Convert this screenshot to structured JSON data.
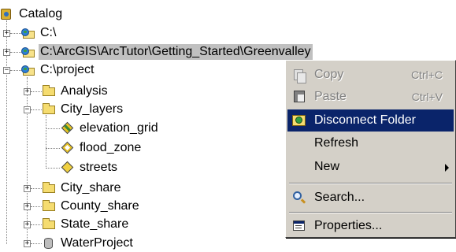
{
  "tree": {
    "root": {
      "label": "Catalog",
      "icon": "catalog-icon"
    },
    "items": [
      {
        "label": "C:\\",
        "icon": "drive-globe-icon",
        "expander": "+"
      },
      {
        "label": "C:\\ArcGIS\\ArcTutor\\Getting_Started\\Greenvalley",
        "icon": "drive-globe-icon",
        "expander": "+",
        "selected": true
      },
      {
        "label": "C:\\project",
        "icon": "drive-globe-icon",
        "expander": "−"
      },
      {
        "label": "Analysis",
        "icon": "folder-icon",
        "expander": "+"
      },
      {
        "label": "City_layers",
        "icon": "folder-icon",
        "expander": "−"
      },
      {
        "label": "elevation_grid",
        "icon": "raster-icon"
      },
      {
        "label": "flood_zone",
        "icon": "polygon-layer-icon"
      },
      {
        "label": "streets",
        "icon": "line-layer-icon"
      },
      {
        "label": "City_share",
        "icon": "folder-icon",
        "expander": "+"
      },
      {
        "label": "County_share",
        "icon": "folder-icon",
        "expander": "+"
      },
      {
        "label": "State_share",
        "icon": "folder-icon",
        "expander": "+"
      },
      {
        "label": "WaterProject",
        "icon": "database-icon",
        "expander": "+"
      }
    ]
  },
  "context_menu": {
    "items": [
      {
        "label": "Copy",
        "shortcut": "Ctrl+C",
        "icon": "copy-icon",
        "disabled": true
      },
      {
        "label": "Paste",
        "shortcut": "Ctrl+V",
        "icon": "paste-icon",
        "disabled": true
      },
      {
        "label": "Disconnect Folder",
        "icon": "disconnect-folder-icon",
        "highlighted": true
      },
      {
        "label": "Refresh"
      },
      {
        "label": "New",
        "submenu": true
      },
      {
        "label": "Search...",
        "icon": "search-icon"
      },
      {
        "label": "Properties...",
        "icon": "properties-icon"
      }
    ]
  },
  "colors": {
    "highlight": "#0a246a",
    "menu_face": "#d4d0c8",
    "selection_bg": "#c0c0c0"
  }
}
